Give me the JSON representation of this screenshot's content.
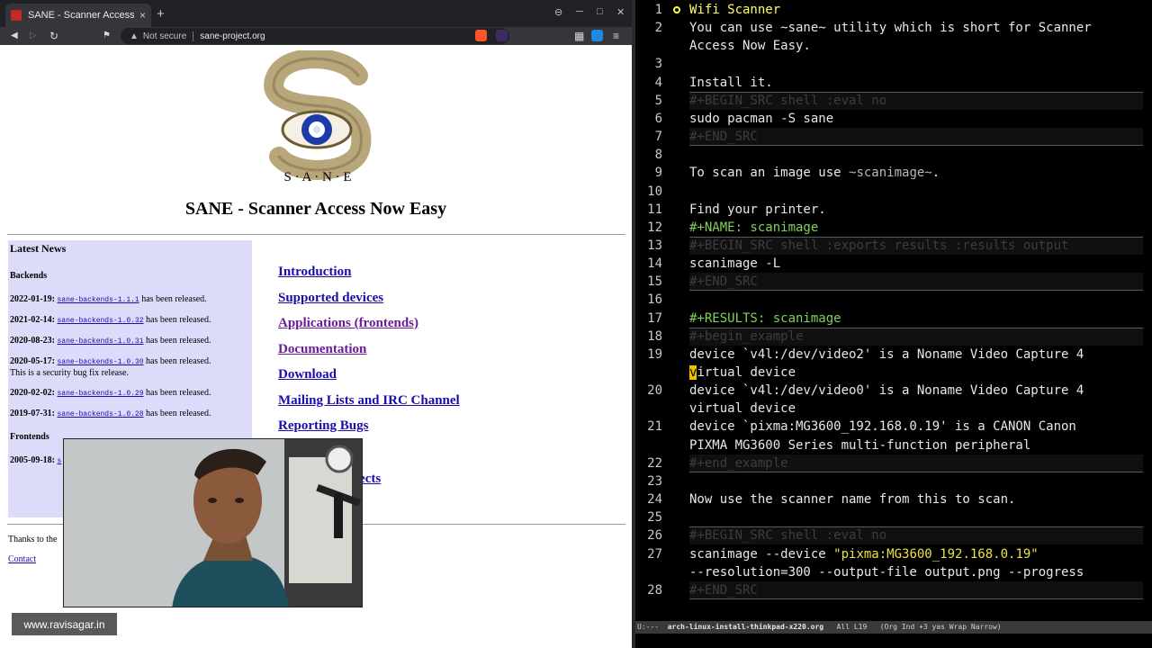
{
  "browser": {
    "tab_title": "SANE - Scanner Access Now Easy",
    "tab_close": "×",
    "new_tab": "+",
    "url_security": "Not secure",
    "url": "sane-project.org",
    "back": "◀",
    "forward": "▷",
    "reload": "↻",
    "bookmark": "⚑",
    "win_ctl": [
      "⊖",
      "─",
      "□",
      "✕"
    ],
    "extensions": [
      "▦",
      "≡"
    ]
  },
  "page": {
    "logo_caption": "S · A · N · E",
    "title": "SANE - Scanner Access Now Easy",
    "news_heading": "Latest News",
    "backends_heading": "Backends",
    "news": [
      {
        "date": "2022-01-19:",
        "link": "sane-backends-1.1.1",
        "text": " has been released.",
        "note": ""
      },
      {
        "date": "2021-02-14:",
        "link": "sane-backends-1.0.32",
        "text": " has been released.",
        "note": ""
      },
      {
        "date": "2020-08-23:",
        "link": "sane-backends-1.0.31",
        "text": " has been released.",
        "note": ""
      },
      {
        "date": "2020-05-17:",
        "link": "sane-backends-1.0.30",
        "text": " has been released.",
        "note": "This is a security bug fix release."
      },
      {
        "date": "2020-02-02:",
        "link": "sane-backends-1.0.29",
        "text": " has been released.",
        "note": ""
      },
      {
        "date": "2019-07-31:",
        "link": "sane-backends-1.0.28",
        "text": " has been released.",
        "note": ""
      }
    ],
    "frontends_heading": "Frontends",
    "frontends_date": "2005-09-18:",
    "frontends_link": "s",
    "nav": [
      "Introduction",
      "Supported devices",
      "Applications (frontends)",
      "Documentation",
      "Download",
      "Mailing Lists and IRC Channel",
      "Reporting Bugs",
      "",
      "Projects"
    ],
    "thanks": "Thanks to the",
    "contact": "Contact"
  },
  "watermark": "www.ravisagar.in",
  "emacs": {
    "lines": [
      {
        "n": "1",
        "text": "Wifi Scanner",
        "style": "c-head",
        "bullet": true
      },
      {
        "n": "2",
        "text": "You can use ~sane~ utility which is short for Scanner",
        "style": ""
      },
      {
        "n": "",
        "text": "Access Now Easy.",
        "style": ""
      },
      {
        "n": "3",
        "text": "",
        "style": ""
      },
      {
        "n": "4",
        "text": "Install it.",
        "style": ""
      },
      {
        "n": "5",
        "text": "#+BEGIN_SRC shell :eval no",
        "style": "c-dim",
        "block": "start"
      },
      {
        "n": "6",
        "text": "sudo pacman -S sane",
        "style": "",
        "block": "mid"
      },
      {
        "n": "7",
        "text": "#+END_SRC",
        "style": "c-dim",
        "block": "end"
      },
      {
        "n": "8",
        "text": "",
        "style": ""
      },
      {
        "n": "9",
        "text": "To scan an image use ~scanimage~.",
        "style": "",
        "code": "~scanimage~"
      },
      {
        "n": "10",
        "text": "",
        "style": ""
      },
      {
        "n": "11",
        "text": "Find your printer.",
        "style": ""
      },
      {
        "n": "12",
        "text": "#+NAME: scanimage",
        "style": "c-kw"
      },
      {
        "n": "13",
        "text": "#+BEGIN_SRC shell :exports results :results output",
        "style": "c-dim",
        "block": "start"
      },
      {
        "n": "14",
        "text": "scanimage -L",
        "style": "",
        "block": "mid"
      },
      {
        "n": "15",
        "text": "#+END_SRC",
        "style": "c-dim",
        "block": "end"
      },
      {
        "n": "16",
        "text": "",
        "style": ""
      },
      {
        "n": "17",
        "text": "#+RESULTS: scanimage",
        "style": "c-kw"
      },
      {
        "n": "18",
        "text": "#+begin_example",
        "style": "c-dim",
        "block": "start"
      },
      {
        "n": "19",
        "text": "device `v4l:/dev/video2' is a Noname Video Capture 4",
        "style": ""
      },
      {
        "n": "",
        "text": "virtual device",
        "style": "",
        "cursor": true
      },
      {
        "n": "20",
        "text": "device `v4l:/dev/video0' is a Noname Video Capture 4",
        "style": ""
      },
      {
        "n": "",
        "text": "virtual device",
        "style": ""
      },
      {
        "n": "21",
        "text": "device `pixma:MG3600_192.168.0.19' is a CANON Canon",
        "style": ""
      },
      {
        "n": "",
        "text": "PIXMA MG3600 Series multi-function peripheral",
        "style": ""
      },
      {
        "n": "22",
        "text": "#+end_example",
        "style": "c-dim",
        "block": "end"
      },
      {
        "n": "23",
        "text": "",
        "style": ""
      },
      {
        "n": "24",
        "text": "Now use the scanner name from this to scan.",
        "style": ""
      },
      {
        "n": "25",
        "text": "",
        "style": ""
      },
      {
        "n": "26",
        "text": "#+BEGIN_SRC shell :eval no",
        "style": "c-dim",
        "block": "start"
      },
      {
        "n": "27",
        "text": "scanimage --device ",
        "style": "",
        "str": "\"pixma:MG3600_192.168.0.19\"",
        "block": "mid"
      },
      {
        "n": "",
        "text": "--resolution=300 --output-file output.png --progress",
        "style": "",
        "block": "mid"
      },
      {
        "n": "28",
        "text": "#+END_SRC",
        "style": "c-dim",
        "block": "end"
      }
    ],
    "modeline": {
      "state": "U:---  ",
      "buffer": "arch-linux-install-thinkpad-x220.org",
      "pos": "   All L19   ",
      "mode": "(Org Ind +3 yas Wrap Narrow)"
    }
  },
  "colors": {
    "link": "#1a0dab",
    "news_bg": "#dcdcfa",
    "heading_yellow": "#ffff66",
    "keyword_green": "#7fd35a"
  }
}
